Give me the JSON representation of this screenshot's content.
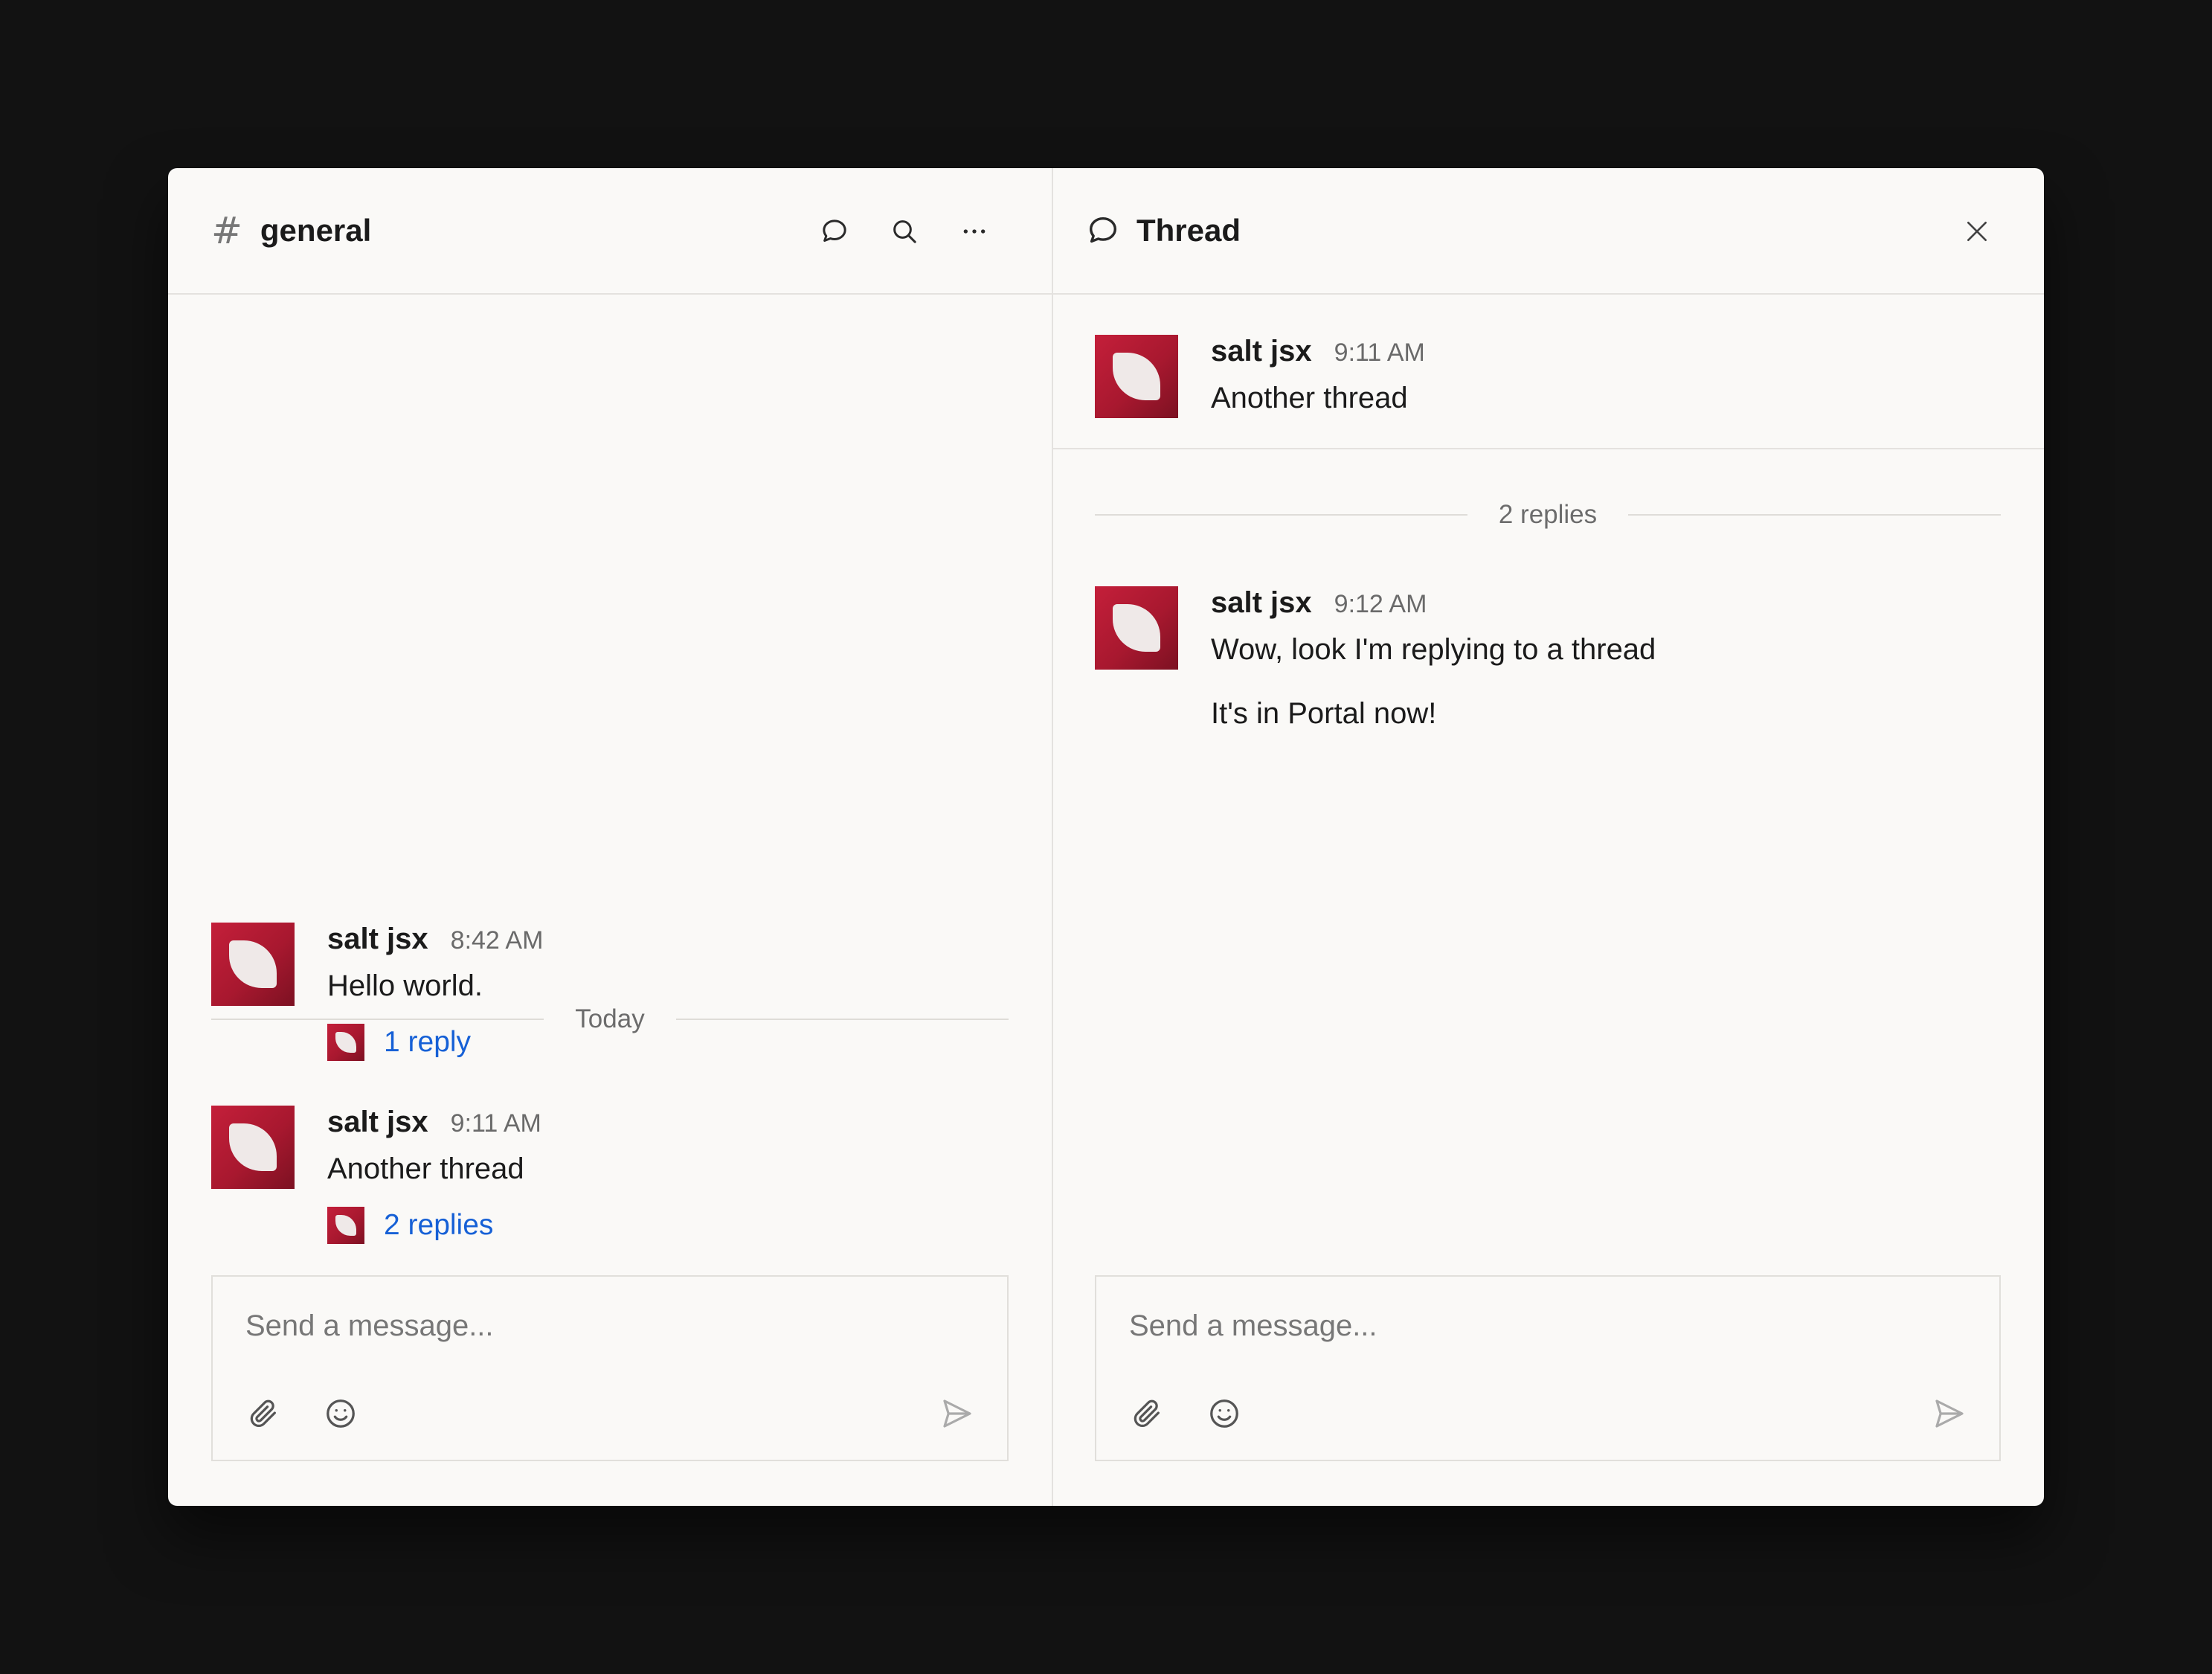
{
  "channel": {
    "hash": "#",
    "name": "general",
    "date_separator": "Today",
    "messages": [
      {
        "author": "salt jsx",
        "time": "8:42 AM",
        "text": "Hello world.",
        "reply_label": "1 reply"
      },
      {
        "author": "salt jsx",
        "time": "9:11 AM",
        "text": "Another thread",
        "reply_label": "2 replies"
      }
    ],
    "composer": {
      "placeholder": "Send a message..."
    }
  },
  "thread": {
    "title": "Thread",
    "root": {
      "author": "salt jsx",
      "time": "9:11 AM",
      "text": "Another thread"
    },
    "replies_separator": "2 replies",
    "replies": [
      {
        "author": "salt jsx",
        "time": "9:12 AM",
        "text": "Wow, look I'm replying to a thread",
        "text2": "It's in Portal now!"
      }
    ],
    "composer": {
      "placeholder": "Send a message..."
    }
  },
  "icons": {
    "threads": "speech-bubble-icon",
    "search": "search-icon",
    "more": "more-horizontal-icon",
    "close": "close-icon",
    "attach": "paperclip-icon",
    "emoji": "smiley-icon",
    "send": "send-icon"
  }
}
